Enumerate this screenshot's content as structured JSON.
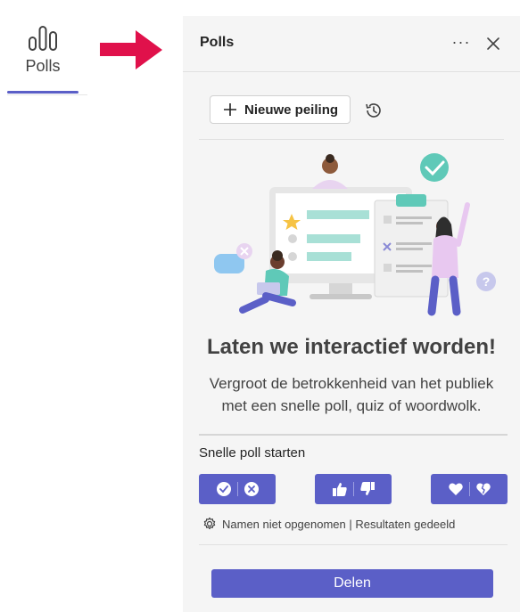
{
  "sidebar": {
    "tab_label": "Polls",
    "tab_icon": "poll-bars-icon",
    "accent": "#5b5fc7"
  },
  "annotation": {
    "arrow_icon": "red-arrow-icon",
    "arrow_color": "#e0114b"
  },
  "panel": {
    "title": "Polls",
    "more_icon": "more-options-icon",
    "more_label": "···",
    "close_icon": "close-icon",
    "new_poll_label": "Nieuwe peiling",
    "history_icon": "history-icon",
    "headline": "Laten we interactief worden!",
    "description": "Vergroot de betrokkenheid van het publiek met een snelle poll, quiz of woordwolk.",
    "quick_poll_title": "Snelle poll starten",
    "quick_polls": [
      {
        "name": "check-cross",
        "icons": [
          "check-circle-icon",
          "cross-circle-icon"
        ]
      },
      {
        "name": "thumbs",
        "icons": [
          "thumbs-up-icon",
          "thumbs-down-icon"
        ]
      },
      {
        "name": "hearts",
        "icons": [
          "heart-icon",
          "broken-heart-icon"
        ]
      }
    ],
    "settings_text": "Namen niet opgenomen | Resultaten gedeeld",
    "settings_icon": "gear-icon",
    "share_label": "Delen",
    "button_color": "#5b5fc7"
  }
}
